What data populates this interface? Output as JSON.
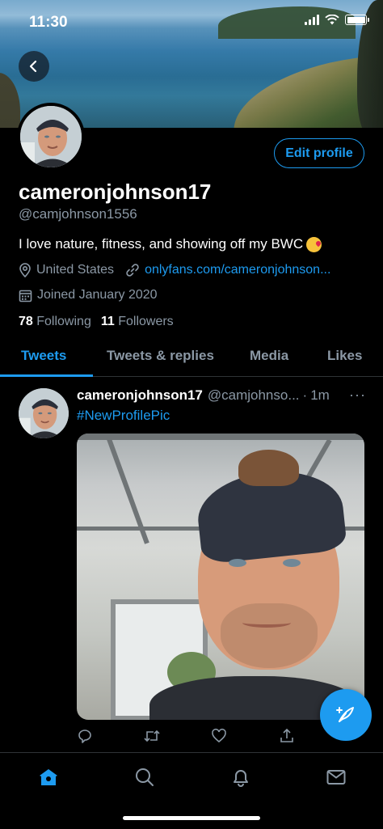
{
  "status_bar": {
    "time": "11:30"
  },
  "profile": {
    "display_name": "cameronjohnson17",
    "handle": "@camjohnson1556",
    "bio": "I love nature, fitness, and showing off my BWC",
    "location": "United States",
    "website": "onlyfans.com/cameronjohnson...",
    "joined": "Joined January 2020",
    "following_count": "78",
    "following_label": "Following",
    "followers_count": "11",
    "followers_label": "Followers",
    "edit_button": "Edit profile"
  },
  "tabs": [
    {
      "label": "Tweets",
      "active": true
    },
    {
      "label": "Tweets & replies",
      "active": false
    },
    {
      "label": "Media",
      "active": false
    },
    {
      "label": "Likes",
      "active": false
    }
  ],
  "tweet": {
    "name": "cameronjohnson17",
    "handle": "@camjohnso...",
    "separator": "·",
    "time": "1m",
    "more": "···",
    "text": "#NewProfilePic"
  },
  "colors": {
    "accent": "#1d9bf0",
    "secondary_text": "#8b98a5",
    "background": "#000000"
  },
  "icons": [
    "back-arrow-icon",
    "location-pin-icon",
    "link-icon",
    "calendar-icon",
    "reply-icon",
    "retweet-icon",
    "like-icon",
    "share-icon",
    "compose-icon",
    "home-icon",
    "search-icon",
    "notifications-icon",
    "messages-icon"
  ]
}
